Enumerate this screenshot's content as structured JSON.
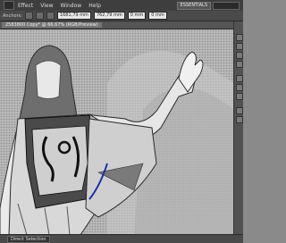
{
  "menubar": {
    "items": [
      "Effect",
      "View",
      "Window",
      "Help"
    ],
    "workspace": "ESSENTIALS"
  },
  "controlbar": {
    "anchors_label": "Anchors:",
    "x_value": "1681,79 mm",
    "y_value": "762,79 mm",
    "w_value": "0 mm",
    "h_value": "0 mm"
  },
  "document_tab": {
    "label": "2583800 Copy* @ 66,67% (RGB/Preview)"
  },
  "statusbar": {
    "tool": "Direct Selection"
  },
  "colors": {
    "menubar": "#3e3e3e",
    "canvas": "#9a9a9a"
  }
}
